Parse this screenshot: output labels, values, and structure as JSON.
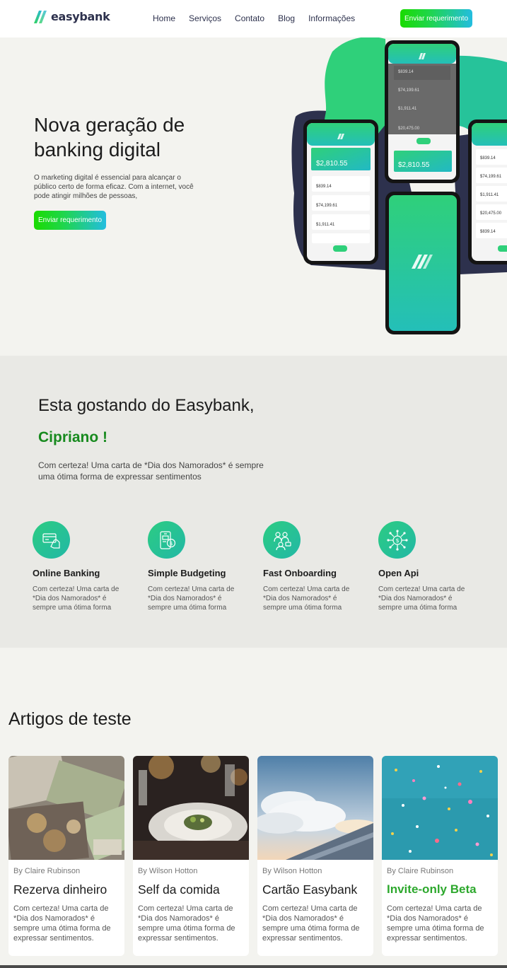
{
  "brand": {
    "name": "easybank",
    "accent_green": "#1adb00",
    "accent_cyan": "#23bde0",
    "title_green": "#178a1e"
  },
  "nav": {
    "items": [
      "Home",
      "Serviços",
      "Contato",
      "Blog",
      "Informações"
    ]
  },
  "header": {
    "cta_label": "Enviar requerimento"
  },
  "hero": {
    "title": "Nova geração de banking digital",
    "text": "O marketing digital é essencial para alcançar o público certo de forma eficaz. Com a internet, você pode atingir milhões de pessoas,",
    "cta_label": "Enviar requerimento"
  },
  "phones": {
    "balance": "$2,810.55",
    "amounts": [
      "$839.14",
      "$74,199.61",
      "$1,911.41",
      "$20,475.00"
    ]
  },
  "gostando": {
    "title": "Esta gostando do Easybank,",
    "name": "Cipriano !",
    "text": "Com certeza! Uma carta de *Dia dos Namorados* é sempre uma ótima forma de expressar sentimentos"
  },
  "features": [
    {
      "icon": "card-hand-icon",
      "title": "Online Banking",
      "text": "Com certeza! Uma carta de *Dia dos Namorados* é sempre uma ótima forma"
    },
    {
      "icon": "phone-coin-icon",
      "title": "Simple Budgeting",
      "text": "Com certeza! Uma carta de *Dia dos Namorados* é sempre uma ótima forma"
    },
    {
      "icon": "people-onboarding-icon",
      "title": "Fast Onboarding",
      "text": "Com certeza! Uma carta de *Dia dos Namorados* é sempre uma ótima forma"
    },
    {
      "icon": "circuit-chip-icon",
      "title": "Open Api",
      "text": "Com certeza! Uma carta de *Dia dos Namorados* é sempre uma ótima forma"
    }
  ],
  "articles_section": {
    "title": "Artigos de teste"
  },
  "articles": [
    {
      "image": "money-photo",
      "author": "By Claire Rubinson",
      "title": "Rezerva dinheiro",
      "text": "Com certeza! Uma carta de *Dia dos Namorados* é sempre uma ótima forma de expressar sentimentos."
    },
    {
      "image": "restaurant-plate-photo",
      "author": "By Wilson Hotton",
      "title": "Self da comida",
      "text": "Com certeza! Uma carta de *Dia dos Namorados* é sempre uma ótima forma de expressar sentimentos."
    },
    {
      "image": "airplane-wing-photo",
      "author": "By Wilson Hotton",
      "title": "Cartão Easybank",
      "text": "Com certeza! Uma carta de *Dia dos Namorados* é sempre uma ótima forma de expressar sentimentos."
    },
    {
      "image": "confetti-photo",
      "author": "By Claire Rubinson",
      "title": "Invite-only Beta",
      "text": "Com certeza! Uma carta de *Dia dos Namorados* é sempre uma ótima forma de expressar sentimentos."
    }
  ]
}
